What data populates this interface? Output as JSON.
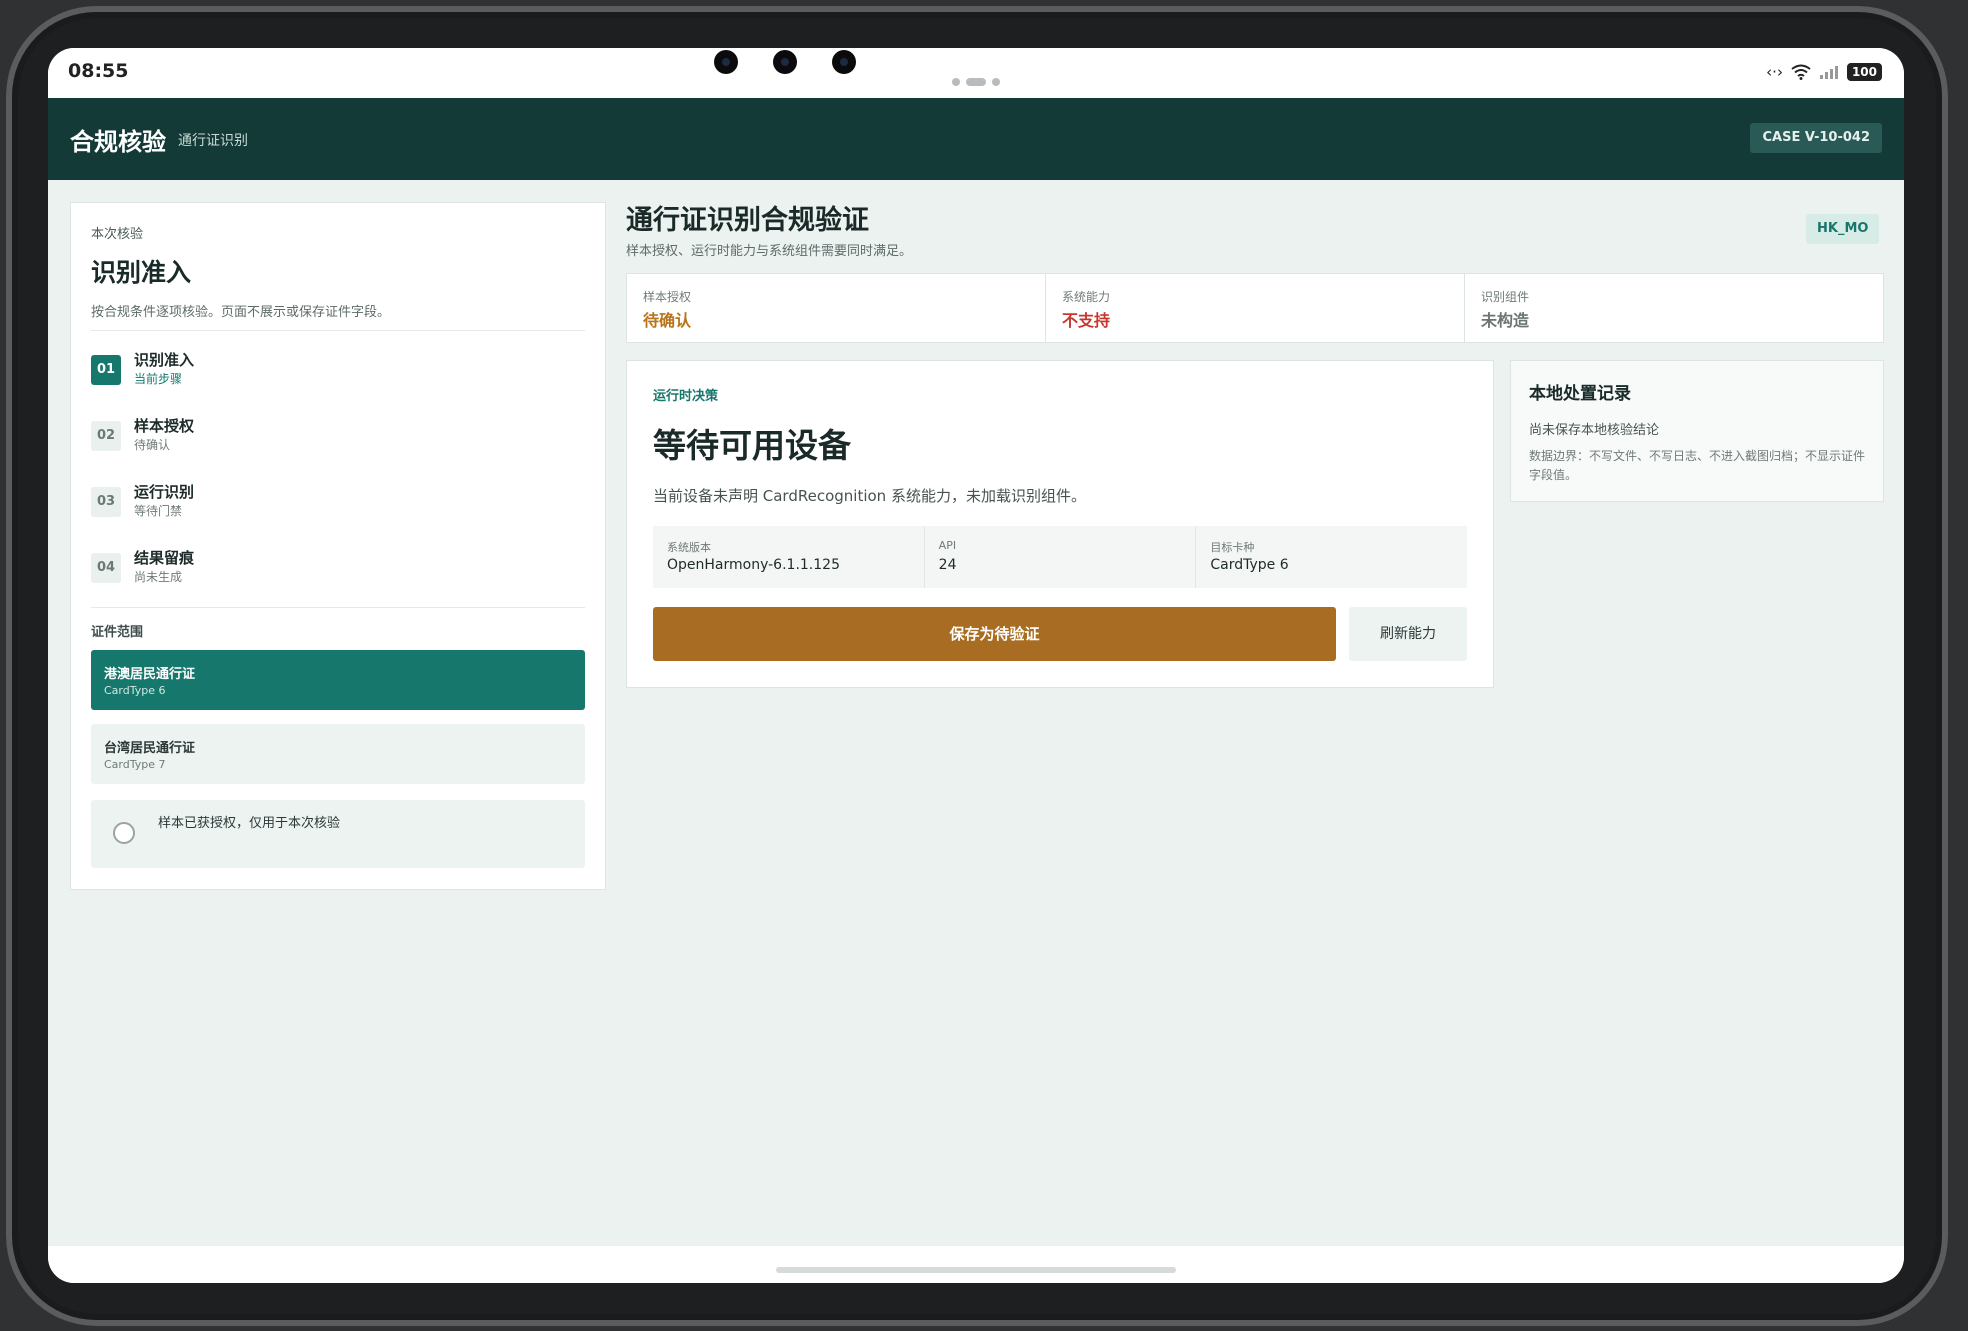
{
  "status_bar": {
    "time": "08:55",
    "battery": "100"
  },
  "header": {
    "title": "合规核验",
    "subtitle": "通行证识别",
    "case_id": "CASE V-10-042"
  },
  "left_panel": {
    "kicker": "本次核验",
    "title": "识别准入",
    "description": "按合规条件逐项核验。页面不展示或保存证件字段。",
    "steps": [
      {
        "num": "01",
        "label": "识别准入",
        "sub": "当前步骤"
      },
      {
        "num": "02",
        "label": "样本授权",
        "sub": "待确认"
      },
      {
        "num": "03",
        "label": "运行识别",
        "sub": "等待门禁"
      },
      {
        "num": "04",
        "label": "结果留痕",
        "sub": "尚未生成"
      }
    ],
    "scope_heading": "证件范围",
    "scope_items": [
      {
        "name": "港澳居民通行证",
        "sub": "CardType 6"
      },
      {
        "name": "台湾居民通行证",
        "sub": "CardType 7"
      }
    ],
    "consent_label": "样本已获授权，仅用于本次核验"
  },
  "main": {
    "title": "通行证识别合规验证",
    "subtitle": "样本授权、运行时能力与系统组件需要同时满足。",
    "region_badge": "HK_MO",
    "status_strip": [
      {
        "label": "样本授权",
        "value": "待确认",
        "color": "#b8741a"
      },
      {
        "label": "系统能力",
        "value": "不支持",
        "color": "#c8372d"
      },
      {
        "label": "识别组件",
        "value": "未构造",
        "color": "#6b7674"
      }
    ],
    "decision": {
      "kicker": "运行时决策",
      "title": "等待可用设备",
      "description": "当前设备未声明 CardRecognition 系统能力，未加载识别组件。",
      "info": [
        {
          "label": "系统版本",
          "value": "OpenHarmony-6.1.1.125"
        },
        {
          "label": "API",
          "value": "24"
        },
        {
          "label": "目标卡种",
          "value": "CardType 6"
        }
      ],
      "primary_button": "保存为待验证",
      "secondary_button": "刷新能力"
    },
    "record": {
      "title": "本地处置记录",
      "status": "尚未保存本地核验结论",
      "note": "数据边界：不写文件、不写日志、不进入截图归档；不显示证件字段值。"
    }
  }
}
